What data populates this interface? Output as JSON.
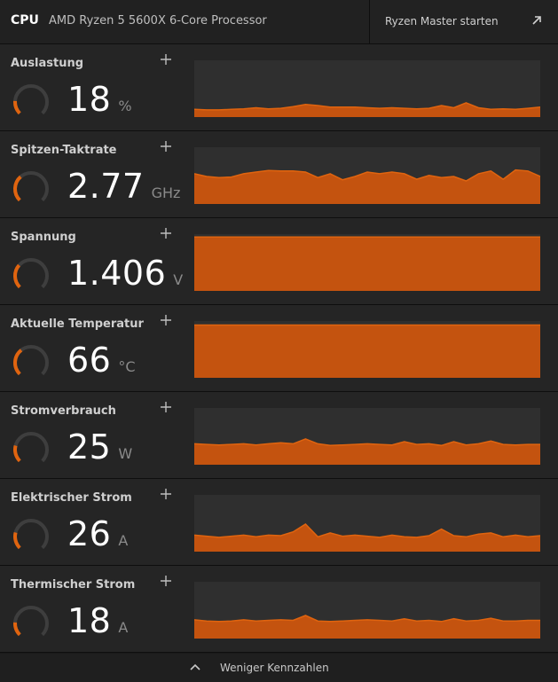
{
  "header": {
    "section": "CPU",
    "processor": "AMD Ryzen 5 5600X 6-Core Processor",
    "launch_button": "Ryzen Master starten"
  },
  "colors": {
    "accent": "#e0640f",
    "fill": "#c4530f",
    "track": "#3e3e3e"
  },
  "metrics": [
    {
      "name": "auslastung",
      "label": "Auslastung",
      "value": "18",
      "unit": "%",
      "gauge_level": 0.18,
      "graph": [
        0.14,
        0.13,
        0.13,
        0.14,
        0.15,
        0.17,
        0.15,
        0.16,
        0.19,
        0.23,
        0.21,
        0.18,
        0.18,
        0.18,
        0.17,
        0.16,
        0.17,
        0.16,
        0.15,
        0.16,
        0.21,
        0.17,
        0.26,
        0.17,
        0.14,
        0.15,
        0.14,
        0.16,
        0.18
      ]
    },
    {
      "name": "spitzen-taktrate",
      "label": "Spitzen-Taktrate",
      "value": "2.77",
      "unit": "GHz",
      "gauge_level": 0.35,
      "graph": [
        0.55,
        0.5,
        0.48,
        0.49,
        0.55,
        0.58,
        0.61,
        0.6,
        0.6,
        0.58,
        0.48,
        0.55,
        0.44,
        0.5,
        0.58,
        0.55,
        0.58,
        0.55,
        0.45,
        0.52,
        0.48,
        0.5,
        0.42,
        0.55,
        0.6,
        0.45,
        0.62,
        0.6,
        0.5
      ]
    },
    {
      "name": "spannung",
      "label": "Spannung",
      "value": "1.406",
      "unit": "V",
      "gauge_level": 0.32,
      "graph": [
        0.98,
        0.98,
        0.98,
        0.98,
        0.98,
        0.98,
        0.98,
        0.98,
        0.98,
        0.98,
        0.98,
        0.98,
        0.98,
        0.98,
        0.98,
        0.98,
        0.98,
        0.98,
        0.98,
        0.98,
        0.98,
        0.98,
        0.98,
        0.98,
        0.98,
        0.98,
        0.98,
        0.98,
        0.98
      ]
    },
    {
      "name": "aktuelle-temperatur",
      "label": "Aktuelle Temperatur",
      "value": "66",
      "unit": "°C",
      "gauge_level": 0.36,
      "graph": [
        0.96,
        0.96,
        0.96,
        0.96,
        0.96,
        0.96,
        0.96,
        0.96,
        0.96,
        0.96,
        0.96,
        0.96,
        0.96,
        0.96,
        0.96,
        0.96,
        0.96,
        0.96,
        0.96,
        0.96,
        0.96,
        0.96,
        0.96,
        0.96,
        0.96,
        0.96,
        0.96,
        0.96,
        0.96
      ]
    },
    {
      "name": "stromverbrauch",
      "label": "Stromverbrauch",
      "value": "25",
      "unit": "W",
      "gauge_level": 0.22,
      "graph": [
        0.38,
        0.37,
        0.36,
        0.37,
        0.38,
        0.36,
        0.38,
        0.4,
        0.38,
        0.47,
        0.38,
        0.35,
        0.36,
        0.37,
        0.38,
        0.37,
        0.36,
        0.42,
        0.37,
        0.38,
        0.35,
        0.42,
        0.36,
        0.38,
        0.43,
        0.37,
        0.36,
        0.37,
        0.37
      ]
    },
    {
      "name": "elektrischer-strom",
      "label": "Elektrischer Strom",
      "value": "26",
      "unit": "A",
      "gauge_level": 0.22,
      "graph": [
        0.3,
        0.28,
        0.26,
        0.28,
        0.3,
        0.27,
        0.3,
        0.29,
        0.36,
        0.5,
        0.27,
        0.34,
        0.28,
        0.3,
        0.28,
        0.26,
        0.3,
        0.27,
        0.26,
        0.29,
        0.41,
        0.29,
        0.27,
        0.32,
        0.34,
        0.27,
        0.3,
        0.27,
        0.29
      ]
    },
    {
      "name": "thermischer-strom",
      "label": "Thermischer Strom",
      "value": "18",
      "unit": "A",
      "gauge_level": 0.18,
      "graph": [
        0.34,
        0.32,
        0.31,
        0.32,
        0.34,
        0.32,
        0.33,
        0.34,
        0.33,
        0.42,
        0.32,
        0.31,
        0.32,
        0.33,
        0.34,
        0.33,
        0.32,
        0.36,
        0.32,
        0.33,
        0.31,
        0.36,
        0.32,
        0.33,
        0.37,
        0.32,
        0.32,
        0.33,
        0.33
      ]
    }
  ],
  "footer": {
    "label": "Weniger Kennzahlen"
  }
}
